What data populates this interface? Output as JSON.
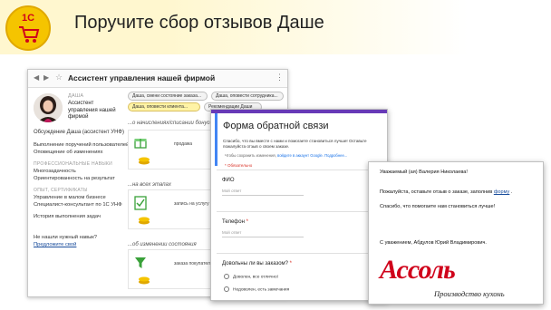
{
  "slide": {
    "logo_text": "1С",
    "title": "Поручите сбор отзывов Даше"
  },
  "assistant_window": {
    "title": "Ассистент управления нашей фирмой",
    "profile_label": "ДАША",
    "profile_name": "Ассистент управления нашей фирмой",
    "discussion": "Обсуждение  Даша (ассистент УНФ)",
    "left_menu": [
      "Выполнение поручений пользователей",
      "Оповещение об изменениях",
      "ПРОФЕССИОНАЛЬНЫЕ НАВЫКИ",
      "Многозадачность",
      "Ориентированность на результат",
      "ОПЫТ, СЕРТИФИКАТЫ",
      "Управление в малом бизнесе",
      "Специалист-консультант по 1С УНФ",
      "История выполнения задач",
      "Не нашли нужный навык?",
      "Предложите свой"
    ],
    "chips": [
      "Даша, смени состояние заказа...",
      "Даша, оповести сотрудника...",
      "Даша, оповести клиента...",
      "Рекомендации Даши"
    ],
    "sections": [
      "...о начислениях/списании бонусов пр",
      "...на всех этапах",
      "...об изменении состояния"
    ],
    "cards": [
      "продажа",
      "запись на услугу",
      "заказа покупателя"
    ]
  },
  "feedback_form": {
    "title": "Форма обратной связи",
    "description": "Спасибо, что вы вместе с нами и помогаете становиться лучше! Оставьте пожалуйста отзыв о своем заказе.",
    "save_hint": "Чтобы сохранить изменения,",
    "save_link": "войдите в аккаунт Google. Подробнее...",
    "required_note": "* Обязательно",
    "fields": [
      {
        "label": "ФИО",
        "placeholder": "Мой ответ"
      },
      {
        "label": "Телефон",
        "placeholder": "Мой ответ"
      }
    ],
    "question": "Довольны ли вы заказом?",
    "options": [
      "Доволен, все отлично!",
      "Недоволен, есть замечания"
    ]
  },
  "email": {
    "greeting": "Уважаемый (ая) Валерия Николаева!",
    "request_prefix": "Пожалуйста, оставьте отзыв о заказе, заполнив",
    "request_link": "форму",
    "request_suffix": ".",
    "thanks": "Спасибо, что помогаете нам становиться лучше!",
    "signature": "С уважением,  Абдулов Юрий Владимирович.",
    "brand": "Ассоль",
    "brand_subtitle": "Производство кухонь"
  },
  "colors": {
    "logo_yellow": "#f5c400",
    "logo_red": "#d0021b",
    "form_purple": "#673ab7",
    "chip_active": "#fff3a6",
    "brand_red": "#d0021b"
  }
}
